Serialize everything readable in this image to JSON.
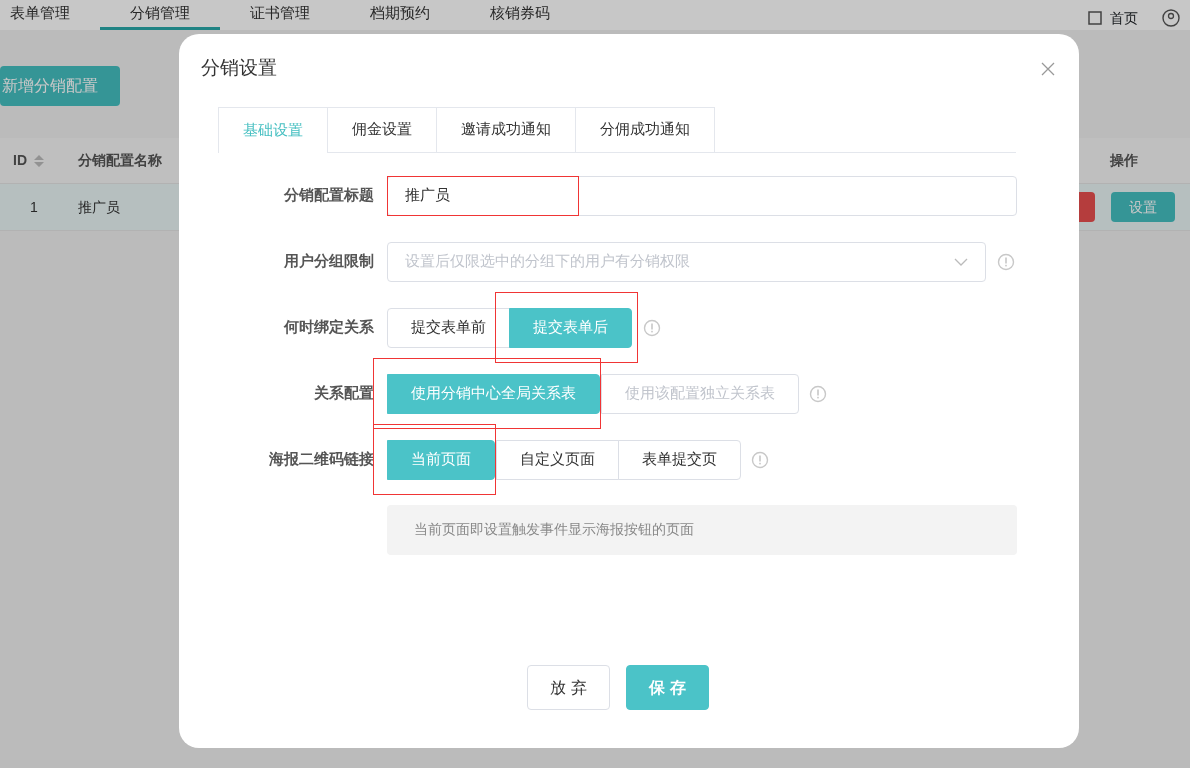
{
  "nav": {
    "items": [
      {
        "label": "表单管理",
        "selected": false
      },
      {
        "label": "分销管理",
        "selected": true
      },
      {
        "label": "证书管理",
        "selected": false
      },
      {
        "label": "档期预约",
        "selected": false
      },
      {
        "label": "核销券码",
        "selected": false
      }
    ],
    "home": "首页"
  },
  "page": {
    "add_button": "新增分销配置",
    "table": {
      "columns": [
        "ID",
        "分销配置名称",
        "操作"
      ],
      "rows": [
        {
          "cells": [
            "1",
            "推广员"
          ],
          "actions": [
            {
              "kind": "danger"
            },
            {
              "kind": "primary",
              "label": "设置"
            }
          ]
        }
      ]
    }
  },
  "dialog": {
    "title": "分销设置",
    "tabs": [
      {
        "label": "基础设置",
        "selected": true
      },
      {
        "label": "佣金设置",
        "selected": false
      },
      {
        "label": "邀请成功通知",
        "selected": false
      },
      {
        "label": "分佣成功通知",
        "selected": false
      }
    ],
    "fields": [
      {
        "kind": "text",
        "label": "分销配置标题",
        "value": "推广员",
        "highlighted": true,
        "info": false
      },
      {
        "kind": "select",
        "label": "用户分组限制",
        "placeholder": "设置后仅限选中的分组下的用户有分销权限",
        "info": true
      },
      {
        "kind": "segmented",
        "label": "何时绑定关系",
        "info": true,
        "options": [
          {
            "label": "提交表单前",
            "selected": false,
            "disabled": false,
            "highlighted": false
          },
          {
            "label": "提交表单后",
            "selected": true,
            "disabled": false,
            "highlighted": true
          }
        ]
      },
      {
        "kind": "segmented",
        "label": "关系配置",
        "info": true,
        "options": [
          {
            "label": "使用分销中心全局关系表",
            "selected": true,
            "disabled": false,
            "highlighted": true
          },
          {
            "label": "使用该配置独立关系表",
            "selected": false,
            "disabled": true,
            "highlighted": false
          }
        ]
      },
      {
        "kind": "segmented",
        "label": "海报二维码链接",
        "info": true,
        "options": [
          {
            "label": "当前页面",
            "selected": true,
            "disabled": false,
            "highlighted": true
          },
          {
            "label": "自定义页面",
            "selected": false,
            "disabled": false,
            "highlighted": false
          },
          {
            "label": "表单提交页",
            "selected": false,
            "disabled": false,
            "highlighted": false
          }
        ]
      }
    ],
    "note": "当前页面即设置触发事件显示海报按钮的页面",
    "buttons": [
      {
        "kind": "secondary",
        "label": "放 弃"
      },
      {
        "kind": "primary",
        "label": "保 存"
      }
    ]
  }
}
